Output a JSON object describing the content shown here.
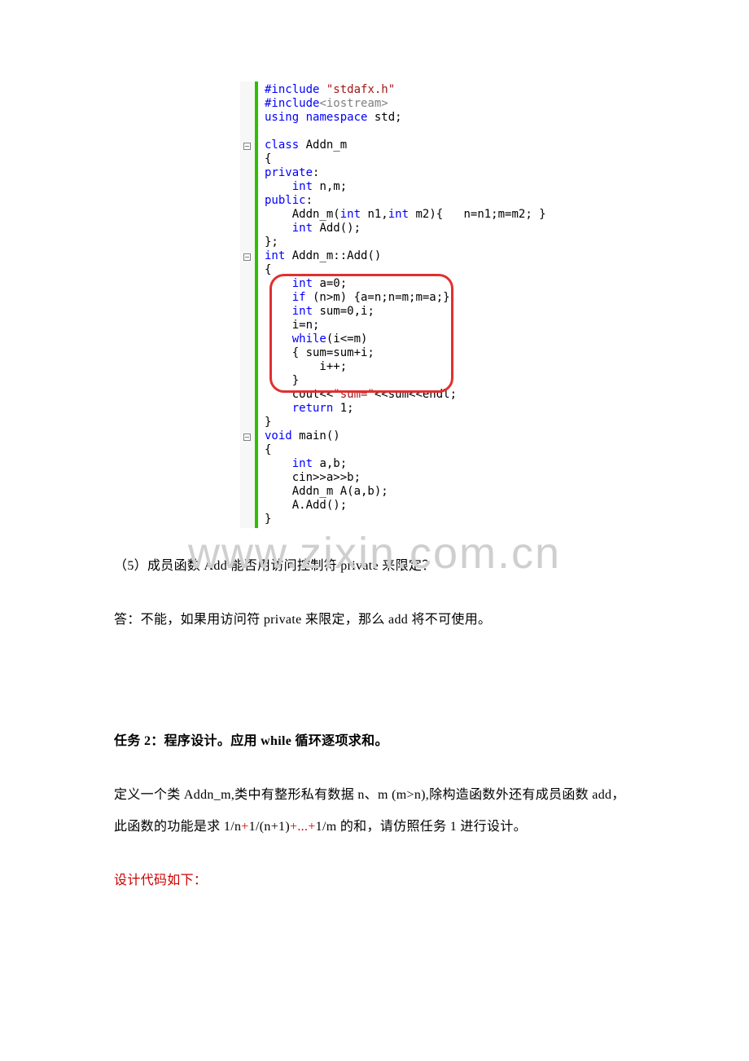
{
  "code": {
    "l01a": "#include",
    "l01b": " \"stdafx.h\"",
    "l02a": "#include",
    "l02b": "<iostream>",
    "l03a": "using",
    "l03b": " ",
    "l03c": "namespace",
    "l03d": " std;",
    "l04": "",
    "l05a": "class",
    "l05b": " Addn_m",
    "l06": "{",
    "l07": "private",
    "l07b": ":",
    "l08a": "    int",
    "l08b": " n,m;",
    "l09": "public",
    "l09b": ":",
    "l10a": "    Addn_m(",
    "l10b": "int",
    "l10c": " n1,",
    "l10d": "int",
    "l10e": " m2){   n=n1;m=m2; }",
    "l11a": "    int",
    "l11b": " Add();",
    "l12": "};",
    "l13a": "int",
    "l13b": " Addn_m::Add()",
    "l14": "{",
    "l15a": "    int",
    "l15b": " a=0;",
    "l16a": "    if",
    "l16b": " (n>m) {a=n;n=m;m=a;}",
    "l17a": "    int",
    "l17b": " sum=0,i;",
    "l18": "    i=n;",
    "l19a": "    while",
    "l19b": "(i<=m)",
    "l20": "    { sum=sum+i;",
    "l21": "        i++;",
    "l22": "    }",
    "l23a": "    cout<<",
    "l23b": "\"sum=\"",
    "l23c": "<<sum<<endl;",
    "l24a": "    return",
    "l24b": " 1;",
    "l25": "}",
    "l26a": "void",
    "l26b": " main()",
    "l27": "{",
    "l28a": "    int",
    "l28b": " a,b;",
    "l29": "    cin>>a>>b;",
    "l30": "    Addn_m A(a,b);",
    "l31": "    A.Add();",
    "l32": "}"
  },
  "body": {
    "q5": "（5）成员函数 Add 能否用访问控制符 private 来限定？",
    "a5": "答：不能，如果用访问符 private 来限定，那么 add 将不可使用。",
    "t2": "任务 2：程序设计。应用 while 循环逐项求和。",
    "p2a_plain1": "定义一个类 Addn_m,类中有整形私有数据 n、m (m>n),除构造函数外还有成员函数 add，此函数的功能是求 1/n",
    "p2a_red1": "+",
    "p2a_plain2": "1/(n+1)",
    "p2a_red2": "+...+",
    "p2a_plain3": "1/m 的和，请仿照任务 1 进行设计。",
    "p3": "设计代码如下："
  },
  "watermark": "www.zixin.com.cn"
}
